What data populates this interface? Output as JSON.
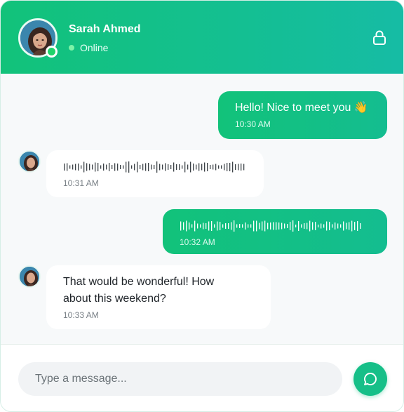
{
  "contact": {
    "name": "Sarah Ahmed",
    "status": "Online"
  },
  "messages": [
    {
      "direction": "outgoing",
      "type": "text",
      "text": "Hello! Nice to meet you 👋",
      "time": "10:30 AM"
    },
    {
      "direction": "incoming",
      "type": "voice",
      "time": "10:31 AM"
    },
    {
      "direction": "outgoing",
      "type": "voice",
      "time": "10:32 AM"
    },
    {
      "direction": "incoming",
      "type": "text",
      "text": "That would be wonderful! How about this weekend?",
      "time": "10:33 AM"
    }
  ],
  "composer": {
    "placeholder": "Type a message..."
  },
  "icons": {
    "header_action": "lock-icon",
    "send": "chat-bubble-icon"
  },
  "colors": {
    "accent": "#12c27a",
    "accent_secondary": "#16bca5",
    "online": "#1fd36a"
  }
}
